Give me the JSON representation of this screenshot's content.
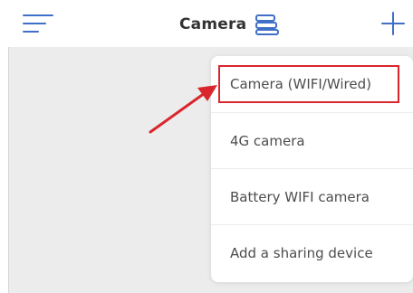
{
  "header": {
    "title": "Camera",
    "left_icon": "menu-icon",
    "title_icon": "camera-list-icon",
    "right_icon": "add-icon"
  },
  "dropdown": {
    "items": [
      {
        "label": "Camera (WIFI/Wired)",
        "highlighted": true
      },
      {
        "label": "4G camera"
      },
      {
        "label": "Battery WIFI camera"
      },
      {
        "label": "Add a sharing device"
      }
    ]
  },
  "annotation": {
    "arrow_icon": "red-arrow-icon",
    "highlight_color": "#d9262c"
  },
  "colors": {
    "accent": "#3f6fc6",
    "background": "#ececec",
    "annotation_red": "#d9262c"
  }
}
